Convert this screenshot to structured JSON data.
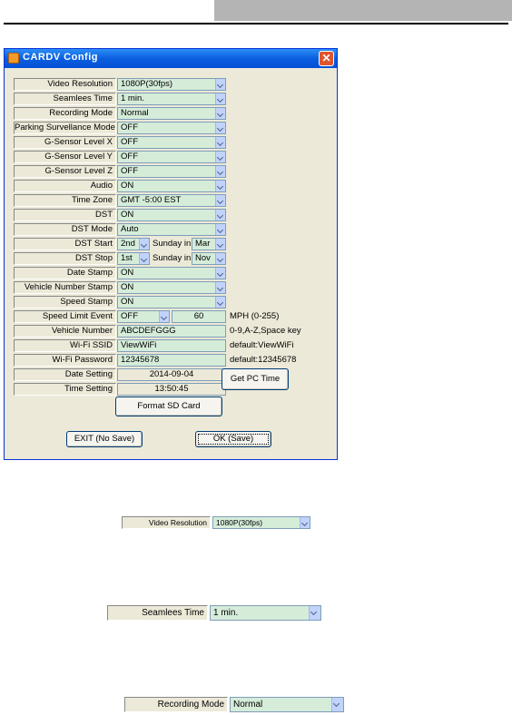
{
  "window": {
    "title": "CARDV Config",
    "close": "✕"
  },
  "rows": {
    "video_resolution": {
      "label": "Video Resolution",
      "value": "1080P(30fps)"
    },
    "seamless_time": {
      "label": "Seamlees Time",
      "value": "1 min."
    },
    "recording_mode": {
      "label": "Recording Mode",
      "value": "Normal"
    },
    "parking": {
      "label": "Parking Survellance Mode",
      "value": "OFF"
    },
    "gsensor_x": {
      "label": "G-Sensor Level X",
      "value": "OFF"
    },
    "gsensor_y": {
      "label": "G-Sensor Level Y",
      "value": "OFF"
    },
    "gsensor_z": {
      "label": "G-Sensor Level Z",
      "value": "OFF"
    },
    "audio": {
      "label": "Audio",
      "value": "ON"
    },
    "time_zone": {
      "label": "Time Zone",
      "value": "GMT -5:00 EST"
    },
    "dst": {
      "label": "DST",
      "value": "ON"
    },
    "dst_mode": {
      "label": "DST Mode",
      "value": "Auto"
    },
    "dst_start": {
      "label": "DST Start",
      "week": "2nd",
      "mid": "Sunday in",
      "month": "Mar"
    },
    "dst_stop": {
      "label": "DST Stop",
      "week": "1st",
      "mid": "Sunday in",
      "month": "Nov"
    },
    "date_stamp": {
      "label": "Date Stamp",
      "value": "ON"
    },
    "vehicle_number_stamp": {
      "label": "Vehicle Number Stamp",
      "value": "ON"
    },
    "speed_stamp": {
      "label": "Speed Stamp",
      "value": "ON"
    },
    "speed_limit": {
      "label": "Speed Limit Event",
      "value": "OFF",
      "number": "60",
      "hint": "MPH (0-255)"
    },
    "vehicle_number": {
      "label": "Vehicle Number",
      "value": "ABCDEFGGG",
      "hint": "0-9,A-Z,Space key"
    },
    "wifi_ssid": {
      "label": "Wi-Fi SSID",
      "value": "ViewWiFi",
      "hint": "default:ViewWiFi"
    },
    "wifi_password": {
      "label": "Wi-Fi Password",
      "value": "12345678",
      "hint": "default:12345678"
    },
    "date_setting": {
      "label": "Date Setting",
      "value": "2014-09-04"
    },
    "time_setting": {
      "label": "Time Setting",
      "value": "13:50:45"
    }
  },
  "buttons": {
    "get_pc_time": "Get PC Time",
    "format_sd": "Format SD Card",
    "exit": "EXIT (No Save)",
    "ok": "OK (Save)"
  },
  "samples": {
    "video_resolution": {
      "label": "Video Resolution",
      "value": "1080P(30fps)"
    },
    "seamless_time": {
      "label": "Seamlees Time",
      "value": "1 min."
    },
    "recording_mode": {
      "label": "Recording Mode",
      "value": "Normal"
    }
  },
  "colors": {
    "field_green": "#d5ecd9",
    "dialog_bg": "#ece9d8",
    "titlebar": "#0a5fe0",
    "header_tab": "#b4b4b4"
  }
}
